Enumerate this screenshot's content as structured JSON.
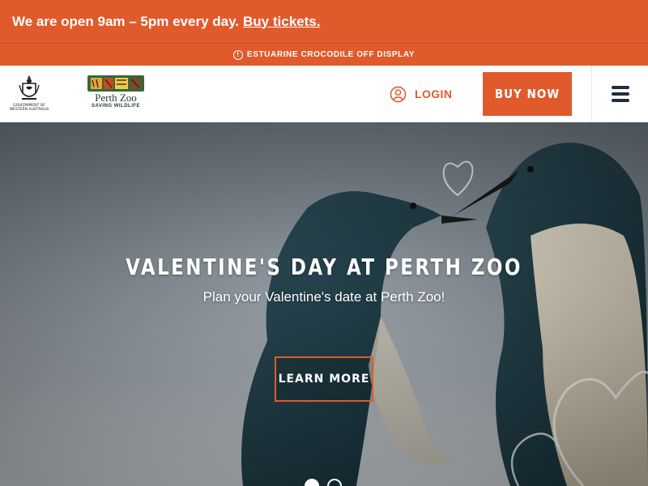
{
  "promo": {
    "text": "We are open 9am – 5pm every day.",
    "link": "Buy tickets."
  },
  "alert": {
    "text": "ESTUARINE CROCODILE OFF DISPLAY"
  },
  "nav": {
    "gov_logo_text": "GOVERNMENT OF WESTERN AUSTRALIA",
    "zoo_logo_name": "Perth Zoo",
    "zoo_logo_tag": "SAVING WILDLIFE",
    "login_label": "LOGIN",
    "buy_label": "BUY NOW"
  },
  "hero": {
    "title": "VALENTINE'S DAY AT PERTH ZOO",
    "subtitle": "Plan your Valentine's date at Perth Zoo!",
    "cta_label": "LEARN MORE",
    "slides": 2,
    "active_slide": 1
  },
  "colors": {
    "accent": "#e05a2b",
    "white": "#ffffff",
    "menu_icon": "#1f2d3d"
  },
  "icons": [
    "alert-icon",
    "user-icon",
    "hamburger-icon",
    "crest-icon"
  ]
}
